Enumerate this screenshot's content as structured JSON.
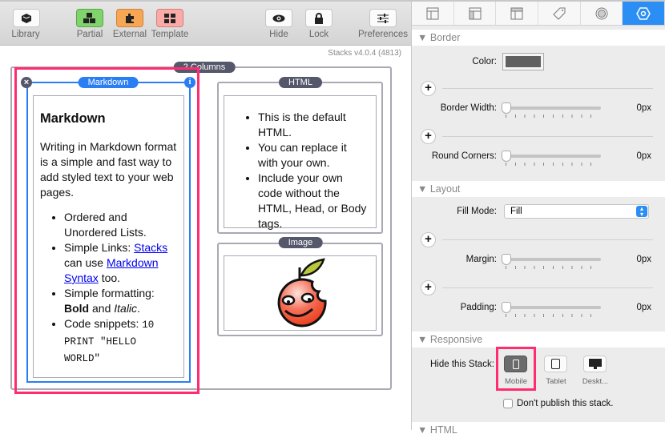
{
  "toolbar": {
    "items": [
      {
        "label": "Library",
        "icon": "cube-icon",
        "color": "#fbfbfb"
      },
      {
        "label": "Partial",
        "icon": "cubes-icon",
        "color": "#7fd46b"
      },
      {
        "label": "External",
        "icon": "puzzle-icon",
        "color": "#f7a654"
      },
      {
        "label": "Template",
        "icon": "grid-icon",
        "color": "#fbaaa8"
      },
      {
        "label": "Hide",
        "icon": "eye-icon",
        "color": "#fbfbfb"
      },
      {
        "label": "Lock",
        "icon": "lock-icon",
        "color": "#fbfbfb"
      },
      {
        "label": "Preferences",
        "icon": "sliders-icon",
        "color": "#fbfbfb"
      }
    ]
  },
  "canvas": {
    "version": "Stacks v4.0.4 (4813)",
    "columns_label": "2 Columns",
    "markdown": {
      "label": "Markdown",
      "heading": "Markdown",
      "para": "Writing in Markdown format is a simple and fast way to add styled text to your web pages.",
      "li1": "Ordered and Unordered Lists.",
      "li2_pre": "Simple Links: ",
      "li2_link1": "Stacks",
      "li2_mid": " can use ",
      "li2_link2": "Markdown Syntax",
      "li2_post": " too.",
      "li3_pre": "Simple formatting: ",
      "li3_bold": "Bold",
      "li3_mid": " and ",
      "li3_italic": "Italic",
      "li3_post": ".",
      "li4_pre": "Code snippets: ",
      "li4_code": "10 PRINT \"HELLO WORLD\""
    },
    "html": {
      "label": "HTML",
      "items": [
        "This is the default HTML.",
        "You can replace it with your own.",
        "Include your own code without the HTML, Head, or Body tags."
      ]
    },
    "image": {
      "label": "Image"
    },
    "highlight_color": "#ff2d6f",
    "selection_color": "#2a7ef4"
  },
  "panel": {
    "tabs": [
      "layout-icon",
      "layout-sidebar-icon",
      "layout-header-icon",
      "tag-icon",
      "circle-icon",
      "hexagon-settings-icon"
    ],
    "active_tab": 5,
    "border": {
      "title": "Border",
      "color_label": "Color:",
      "color_value": "#606060",
      "width_label": "Border Width:",
      "width_value": "0px",
      "corners_label": "Round Corners:",
      "corners_value": "0px"
    },
    "layout": {
      "title": "Layout",
      "fill_label": "Fill Mode:",
      "fill_value": "Fill",
      "margin_label": "Margin:",
      "margin_value": "0px",
      "padding_label": "Padding:",
      "padding_value": "0px"
    },
    "responsive": {
      "title": "Responsive",
      "hide_label": "Hide this Stack:",
      "mobile": "Mobile",
      "tablet": "Tablet",
      "desktop": "Deskt...",
      "mobile_selected": true,
      "publish_label": "Don't publish this stack.",
      "publish_checked": false
    },
    "next_section": "HTML"
  }
}
